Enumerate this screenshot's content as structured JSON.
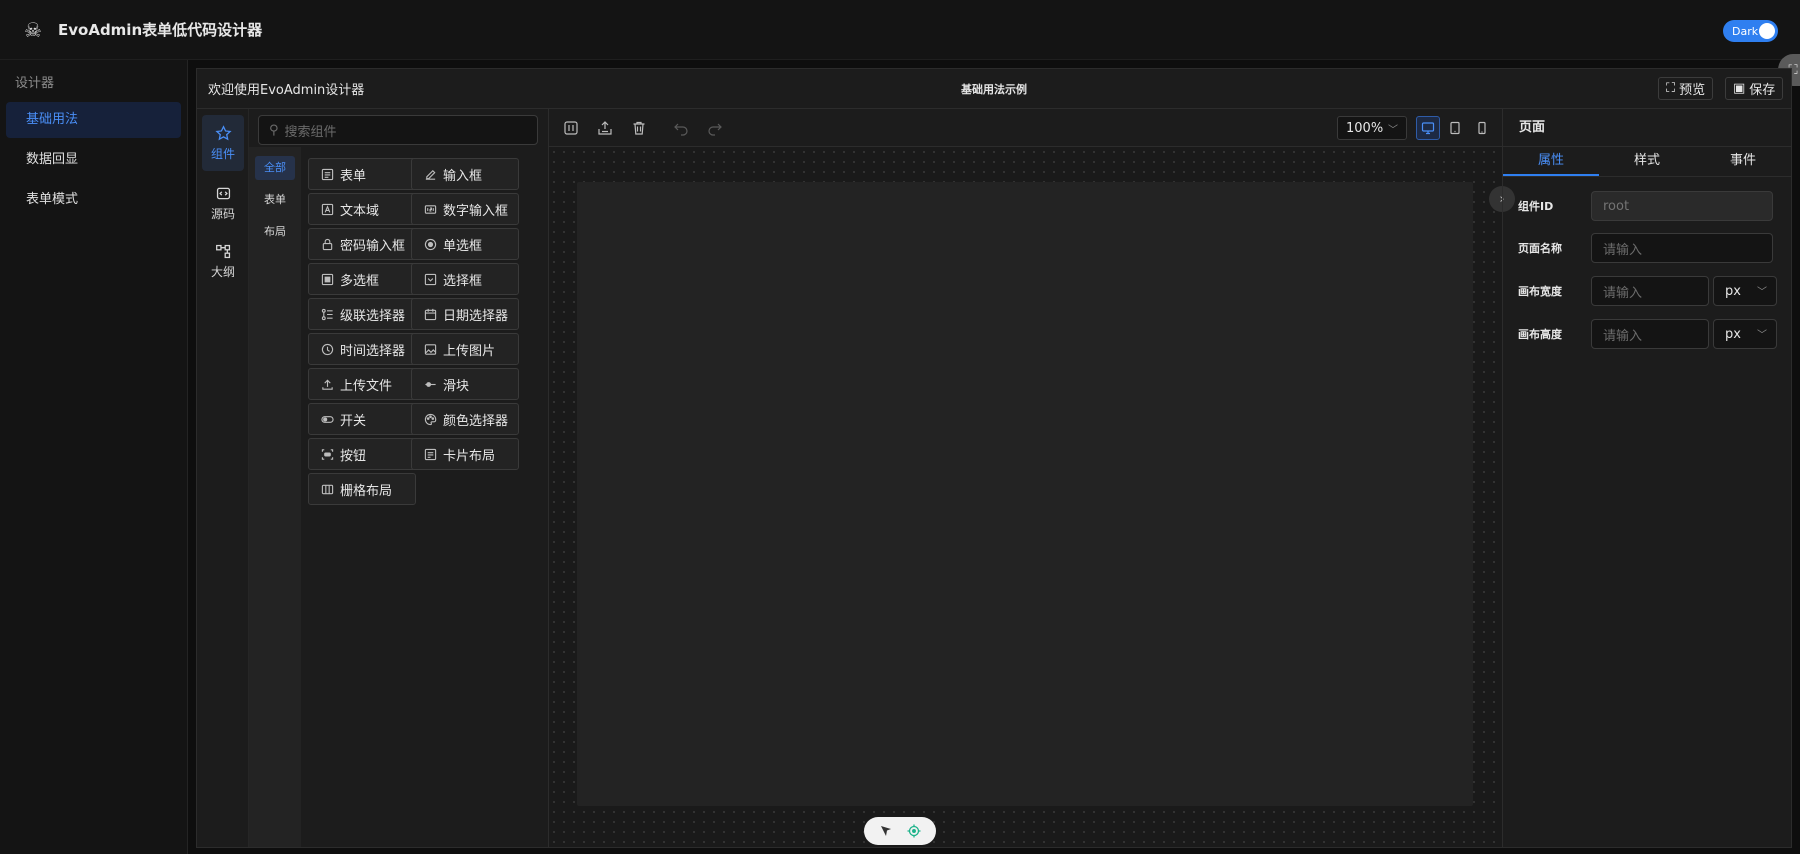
{
  "app": {
    "title": "EvoAdmin表单低代码设计器",
    "theme_toggle_label": "Dark"
  },
  "sidebar": {
    "group_label": "设计器",
    "items": [
      {
        "label": "基础用法",
        "active": true
      },
      {
        "label": "数据回显",
        "active": false
      },
      {
        "label": "表单模式",
        "active": false
      }
    ]
  },
  "designer": {
    "welcome": "欢迎使用EvoAdmin设计器",
    "title": "基础用法示例",
    "preview_label": "预览",
    "save_label": "保存"
  },
  "rail": [
    {
      "label": "组件",
      "icon": "components-icon",
      "active": true
    },
    {
      "label": "源码",
      "icon": "code-icon",
      "active": false
    },
    {
      "label": "大纲",
      "icon": "outline-icon",
      "active": false
    }
  ],
  "search": {
    "placeholder": "搜索组件"
  },
  "categories": [
    {
      "label": "全部",
      "active": true
    },
    {
      "label": "表单",
      "active": false
    },
    {
      "label": "布局",
      "active": false
    }
  ],
  "components": [
    {
      "label": "表单",
      "icon": "form-icon"
    },
    {
      "label": "输入框",
      "icon": "edit-icon"
    },
    {
      "label": "文本域",
      "icon": "textarea-icon"
    },
    {
      "label": "数字输入框",
      "icon": "number-icon"
    },
    {
      "label": "密码输入框",
      "icon": "lock-icon"
    },
    {
      "label": "单选框",
      "icon": "radio-icon"
    },
    {
      "label": "多选框",
      "icon": "checkbox-icon"
    },
    {
      "label": "选择框",
      "icon": "select-icon"
    },
    {
      "label": "级联选择器",
      "icon": "cascader-icon"
    },
    {
      "label": "日期选择器",
      "icon": "calendar-icon"
    },
    {
      "label": "时间选择器",
      "icon": "clock-icon"
    },
    {
      "label": "上传图片",
      "icon": "image-icon"
    },
    {
      "label": "上传文件",
      "icon": "upload-icon"
    },
    {
      "label": "滑块",
      "icon": "slider-icon"
    },
    {
      "label": "开关",
      "icon": "switch-icon"
    },
    {
      "label": "颜色选择器",
      "icon": "palette-icon"
    },
    {
      "label": "按钮",
      "icon": "button-icon"
    },
    {
      "label": "卡片布局",
      "icon": "card-icon"
    },
    {
      "label": "栅格布局",
      "icon": "grid-icon"
    }
  ],
  "toolbar": {
    "zoom": "100%"
  },
  "panel": {
    "title": "页面",
    "tabs": [
      {
        "label": "属性",
        "active": true
      },
      {
        "label": "样式",
        "active": false
      },
      {
        "label": "事件",
        "active": false
      }
    ],
    "fields": {
      "component_id": {
        "label": "组件ID",
        "value": "root"
      },
      "page_name": {
        "label": "页面名称",
        "placeholder": "请输入"
      },
      "canvas_width": {
        "label": "画布宽度",
        "placeholder": "请输入",
        "unit": "px"
      },
      "canvas_height": {
        "label": "画布高度",
        "placeholder": "请输入",
        "unit": "px"
      }
    }
  },
  "colors": {
    "accent": "#2f7ff0",
    "background": "#1c1c1c",
    "canvas": "#232323"
  }
}
